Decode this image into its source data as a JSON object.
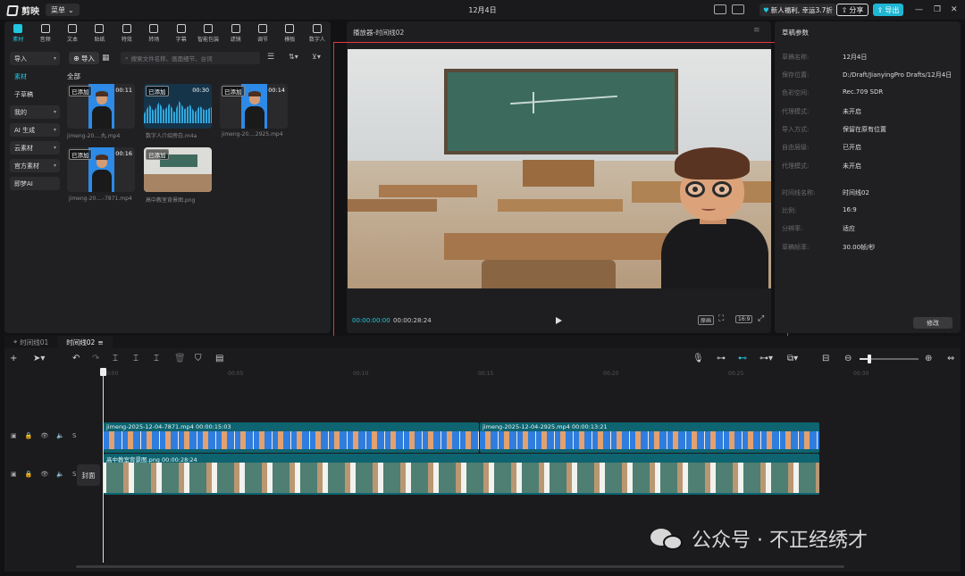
{
  "app": {
    "name": "剪映",
    "menu_label": "菜单",
    "title": "12月4日"
  },
  "topbar": {
    "promo_label": "新人福利, 幸运3.7折",
    "share_label": "分享",
    "export_label": "导出"
  },
  "tooltabs": [
    {
      "label": "素材",
      "icon": "media-icon"
    },
    {
      "label": "音频",
      "icon": "audio-icon"
    },
    {
      "label": "文本",
      "icon": "text-icon"
    },
    {
      "label": "贴纸",
      "icon": "sticker-icon"
    },
    {
      "label": "特效",
      "icon": "effects-icon"
    },
    {
      "label": "转场",
      "icon": "transition-icon"
    },
    {
      "label": "字幕",
      "icon": "caption-icon"
    },
    {
      "label": "智能包装",
      "icon": "smart-pack-icon"
    },
    {
      "label": "滤镜",
      "icon": "filter-icon"
    },
    {
      "label": "调节",
      "icon": "adjust-icon"
    },
    {
      "label": "模板",
      "icon": "template-icon"
    },
    {
      "label": "数字人",
      "icon": "digital-human-icon"
    }
  ],
  "leftnav": [
    {
      "label": "导入",
      "has_arrow": true
    },
    {
      "label": "素材",
      "has_arrow": false
    },
    {
      "label": "子草稿",
      "has_arrow": false
    },
    {
      "label": "我的",
      "has_arrow": true
    },
    {
      "label": "AI 生成",
      "has_arrow": true
    },
    {
      "label": "云素材",
      "has_arrow": true
    },
    {
      "label": "官方素材",
      "has_arrow": true
    },
    {
      "label": "即梦AI",
      "has_arrow": false
    }
  ],
  "media": {
    "import_label": "导入",
    "search_placeholder": "搜索文件名称、画面细节、台词",
    "all_label": "全部",
    "added_label": "已添加",
    "items": [
      {
        "name": "jimeng-20....丸.mp4",
        "duration": "00:11",
        "kind": "video"
      },
      {
        "name": "数字人介绍旁白.m4a",
        "duration": "00:30",
        "kind": "audio"
      },
      {
        "name": "jimeng-20....2925.mp4",
        "duration": "00:14",
        "kind": "video"
      },
      {
        "name": "jimeng-20....-7871.mp4",
        "duration": "00:16",
        "kind": "video"
      },
      {
        "name": "高中教室背景图.png",
        "duration": "",
        "kind": "image"
      }
    ]
  },
  "player": {
    "title": "播放器-时间线02",
    "current_time": "00:00:00:00",
    "total_time": "00:00:28:24",
    "ratio_label": "16:9",
    "original_label": "原画"
  },
  "props": {
    "title": "草稿参数",
    "rows": [
      {
        "k": "草稿名称:",
        "v": "12月4日"
      },
      {
        "k": "保存位置:",
        "v": "D:/Draft/JianyingPro Drafts/12月4日"
      },
      {
        "k": "色彩空间:",
        "v": "Rec.709 SDR"
      },
      {
        "k": "代理模式:",
        "v": "未开启"
      },
      {
        "k": "导入方式:",
        "v": "保留在原有位置"
      },
      {
        "k": "自由层级:",
        "v": "已开启"
      },
      {
        "k": "代理模式:",
        "v": "未开启"
      },
      {
        "k": "时间线名称:",
        "v": "时间线02"
      },
      {
        "k": "比例:",
        "v": "16:9"
      },
      {
        "k": "分辨率:",
        "v": "适应"
      },
      {
        "k": "草稿帧率:",
        "v": "30.00帧/秒"
      }
    ],
    "modify_label": "修改"
  },
  "timeline": {
    "tabs": [
      "时间线01",
      "时间线02"
    ],
    "ruler": [
      "00:00",
      "00:05",
      "00:10",
      "00:15",
      "00:20",
      "00:25",
      "00:30"
    ],
    "cover_label": "封面",
    "clips": {
      "video1": {
        "name": "jimeng-2025-12-04-7871.mp4",
        "duration": "00:00:15:03"
      },
      "video2": {
        "name": "jimeng-2025-12-04-2925.mp4",
        "duration": "00:00:13:21"
      },
      "image": {
        "name": "高中教室背景图.png",
        "duration": "00:00:28:24"
      }
    }
  },
  "watermark": {
    "text": "公众号 · 不正经绣才"
  },
  "colors": {
    "accent": "#1fc7e0",
    "clip": "#0e6470",
    "highlight_box": "#e0383c"
  }
}
